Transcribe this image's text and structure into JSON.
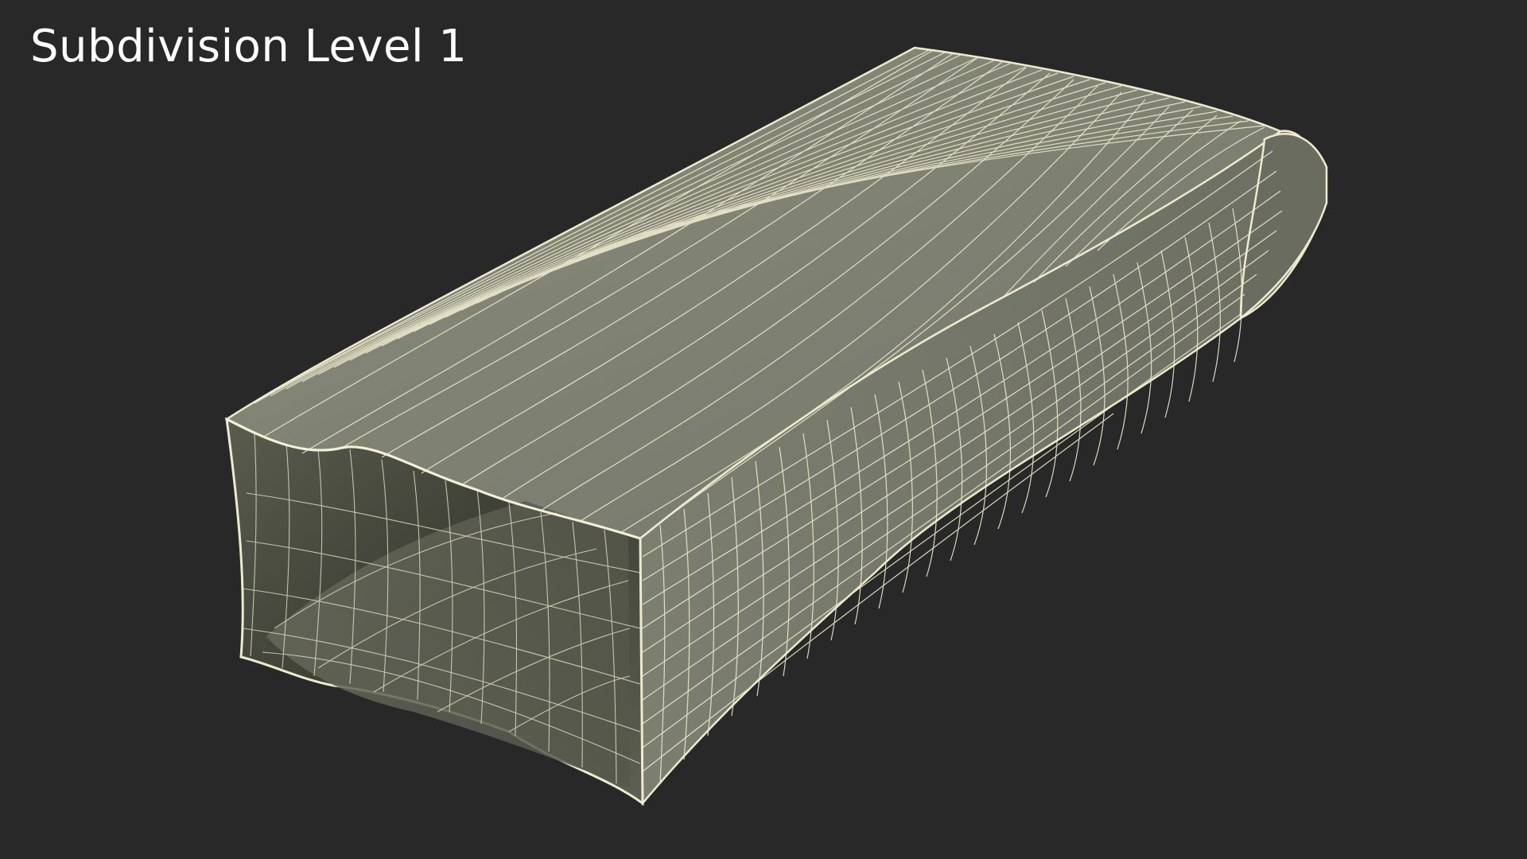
{
  "viewport": {
    "title": "Subdivision Level 1",
    "background_color": "#282828",
    "label_color": "#ffffff"
  },
  "model": {
    "object": "open bag wireframe mesh",
    "surface_color": "#787a6c",
    "inner_shadow_color": "#4a4c40",
    "inside_floor_color": "#5e6052",
    "wire_color": "#eeeacc"
  }
}
